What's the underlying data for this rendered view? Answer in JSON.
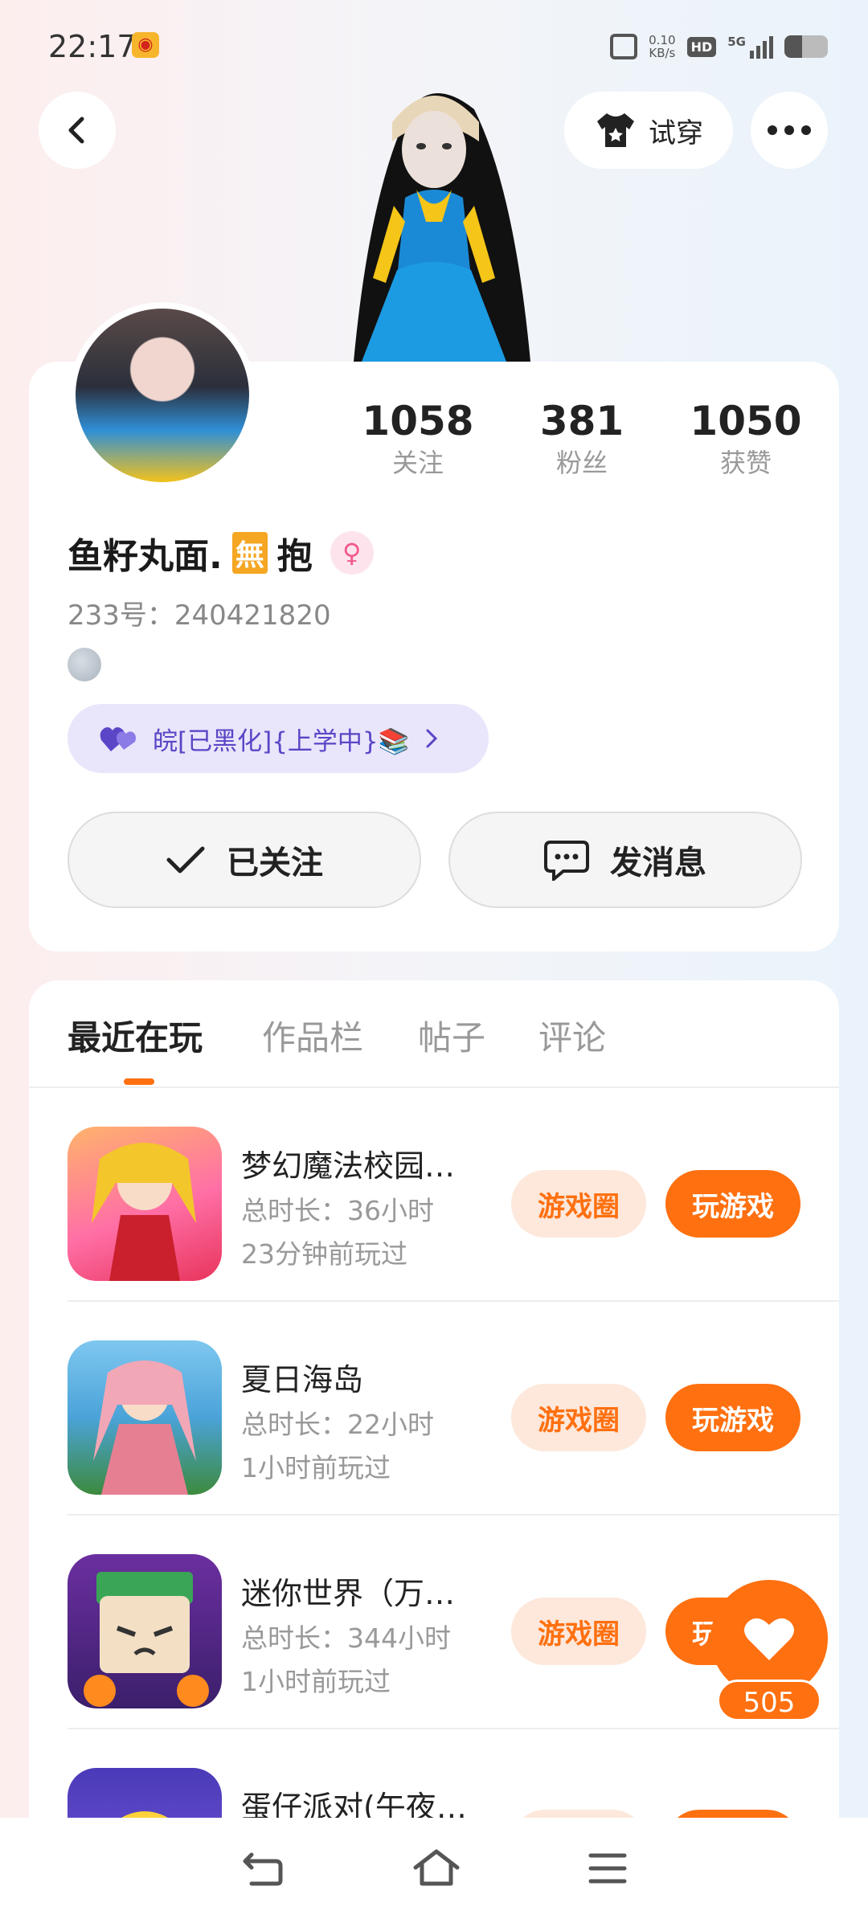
{
  "status_bar": {
    "time": "22:17",
    "net_speed_value": "0.10",
    "net_speed_unit": "KB/s",
    "hd": "HD",
    "network": "5G"
  },
  "header": {
    "try_on_label": "试穿"
  },
  "profile": {
    "stats": [
      {
        "value": "1058",
        "label": "关注"
      },
      {
        "value": "381",
        "label": "粉丝"
      },
      {
        "value": "1050",
        "label": "获赞"
      }
    ],
    "name_prefix": "鱼籽丸面.",
    "name_badge": "無",
    "name_suffix": "抱",
    "uid": "233号：240421820",
    "guild": "皖[已黑化]{上学中}📚",
    "follow_label": "已关注",
    "message_label": "发消息"
  },
  "tabs": [
    "最近在玩",
    "作品栏",
    "帖子",
    "评论"
  ],
  "games": [
    {
      "title": "梦幻魔法校园…",
      "duration": "总时长：36小时",
      "last_played": "23分钟前玩过",
      "circle_label": "游戏圈",
      "play_label": "玩游戏"
    },
    {
      "title": "夏日海岛",
      "duration": "总时长：22小时",
      "last_played": "1小时前玩过",
      "circle_label": "游戏圈",
      "play_label": "玩游戏"
    },
    {
      "title": "迷你世界（万…",
      "duration": "总时长：344小时",
      "last_played": "1小时前玩过",
      "circle_label": "游戏圈",
      "play_label": "玩游戏"
    },
    {
      "title": "蛋仔派对(午夜…",
      "duration": "",
      "last_played": "",
      "circle_label": "",
      "play_label": ""
    }
  ],
  "like": {
    "count": "505"
  },
  "colors": {
    "accent": "#ff7010",
    "guild_bg": "#e9e5fb",
    "guild_text": "#5a46c6"
  }
}
